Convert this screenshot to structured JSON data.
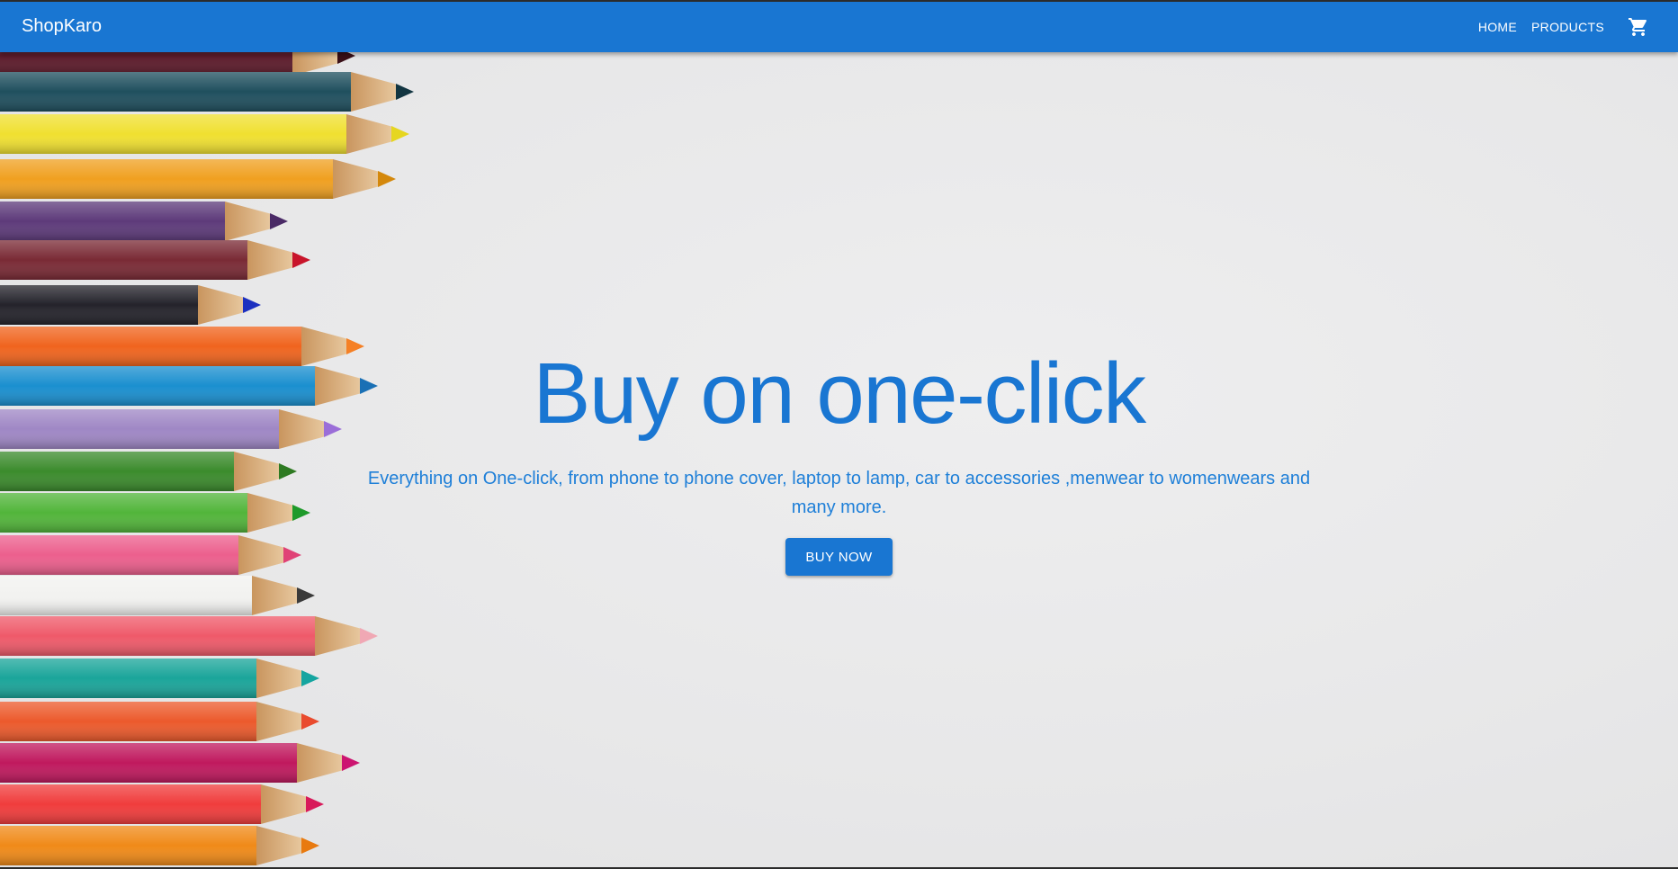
{
  "header": {
    "brand": "ShopKaro",
    "nav": {
      "home_label": "HOME",
      "products_label": "PRODUCTS",
      "cart_icon": "shopping-cart-icon"
    }
  },
  "hero": {
    "title": "Buy on one-click",
    "subtitle": "Everything on One-click, from phone to phone cover, laptop to lamp, car to accessories ,menwear to womenwears and many more.",
    "cta_label": "BUY NOW",
    "background_image": "colored-pencils-photo"
  },
  "colors": {
    "primary": "#1976d2",
    "on_primary": "#ffffff",
    "background": "#e9e9ea"
  }
}
